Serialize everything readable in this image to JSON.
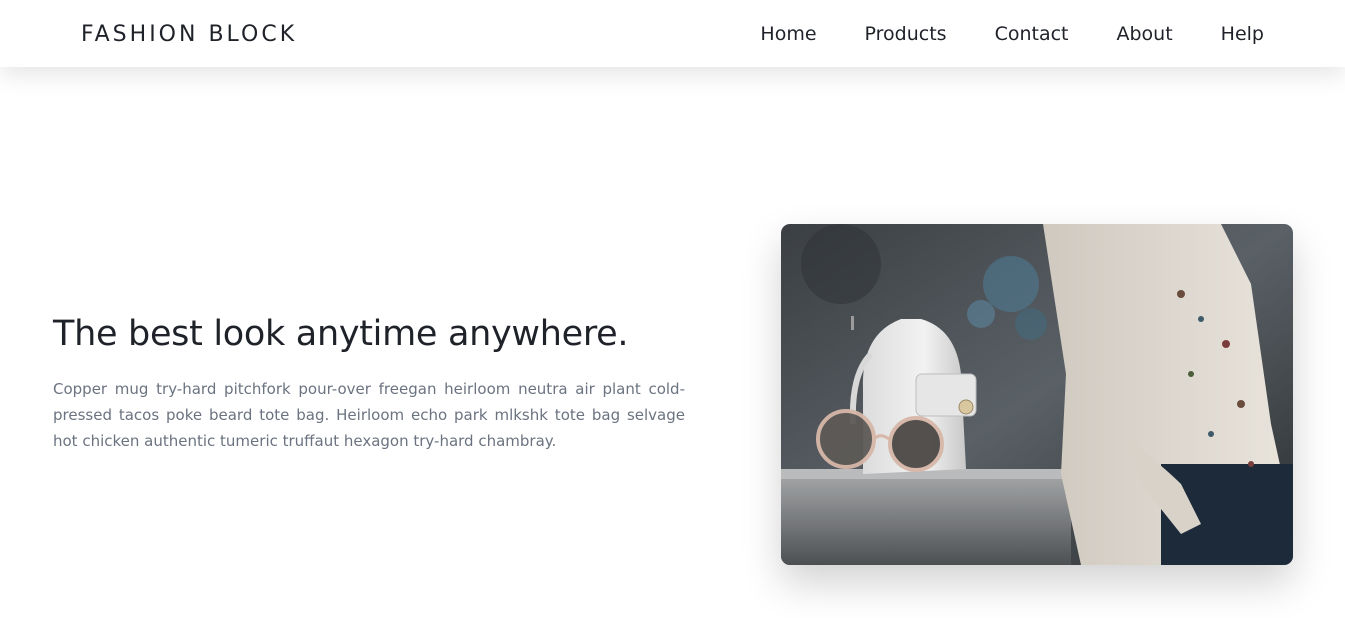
{
  "brand": "FASHION BLOCK",
  "nav": {
    "items": [
      "Home",
      "Products",
      "Contact",
      "About",
      "Help"
    ]
  },
  "hero": {
    "title": "The best look anytime anywhere.",
    "description": "Copper mug try-hard pitchfork pour-over freegan heirloom neutra air plant cold-pressed tacos poke beard tote bag. Heirloom echo park mlkshk tote bag selvage hot chicken authentic tumeric truffaut hexagon try-hard chambray."
  },
  "colors": {
    "text": "#1f2329",
    "muted": "#6b7380",
    "background": "#ffffff"
  }
}
